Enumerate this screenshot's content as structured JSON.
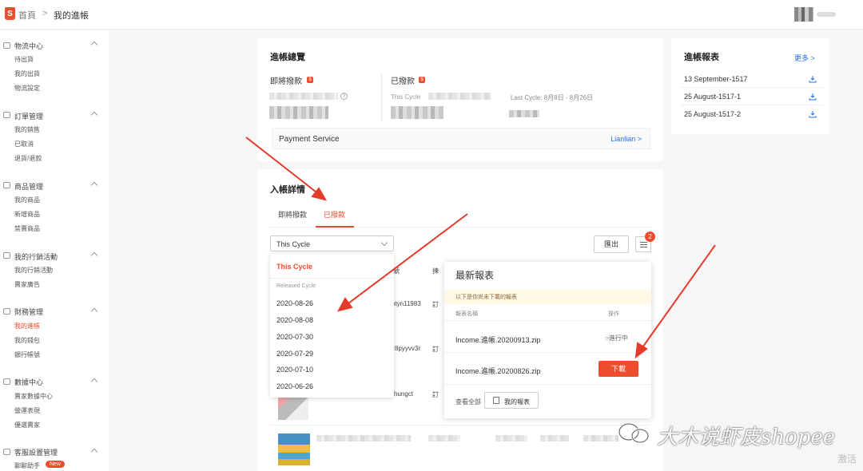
{
  "header": {
    "logo": "S",
    "home": "首頁",
    "separator": ">",
    "current": "我的進帳"
  },
  "sidebar": {
    "sections": [
      {
        "title": "物流中心",
        "items": [
          "待出貨",
          "我的出貨",
          "物流設定"
        ]
      },
      {
        "title": "訂單管理",
        "items": [
          "我的銷售",
          "已取消",
          "退貨/退款"
        ]
      },
      {
        "title": "商品管理",
        "items": [
          "我的商品",
          "新增商品",
          "禁賣商品"
        ]
      },
      {
        "title": "我的行銷活動",
        "items": [
          "我的行銷活動",
          "賣家廣告"
        ]
      },
      {
        "title": "財務管理",
        "items": [
          "我的進帳",
          "我的錢包",
          "銀行帳號"
        ]
      },
      {
        "title": "數據中心",
        "items": [
          "賣家數據中心",
          "營運表現",
          "優選賣家"
        ]
      },
      {
        "title": "客服設置管理",
        "items": [
          "聊聊助手"
        ]
      }
    ],
    "new_badge": "New"
  },
  "overview": {
    "title": "進帳總覽",
    "upcoming_label": "即將撥款",
    "released_label": "已撥款",
    "this_cycle_label": "This Cycle",
    "last_cycle": "Last Cycle: 8月8日 - 8月26日",
    "payment_service": "Payment Service",
    "payment_link": "Lianlian >"
  },
  "details": {
    "title": "入帳詳情",
    "tabs": [
      "即將撥款",
      "已撥款"
    ],
    "select_value": "This Cycle",
    "export_button": "匯出",
    "badge_count": "2",
    "col_partial": "號",
    "col2_partial": "揀",
    "row_texts": [
      "ptyn11983",
      "訂",
      "z8pyyvv3r",
      "訂",
      "hungct",
      "訂"
    ]
  },
  "dropdown": {
    "current": "This Cycle",
    "group": "Released Cycle",
    "options": [
      "2020-08-26",
      "2020-08-08",
      "2020-07-30",
      "2020-07-29",
      "2020-07-10",
      "2020-06-26"
    ]
  },
  "latest_reports": {
    "title": "最新報表",
    "note": "以下是你尚未下載的報表",
    "col_name": "報表名稱",
    "col_action": "操作",
    "files": [
      {
        "name": "Income.進帳.20200913.zip",
        "status": "○進行中"
      },
      {
        "name": "Income.進帳.20200826.zip",
        "action": "下載"
      }
    ],
    "view_all": "查看全部",
    "my_reports_button": "我的報表"
  },
  "reports_panel": {
    "title": "進帳報表",
    "more": "更多 >",
    "items": [
      "13 September-1517",
      "25 August-1517-1",
      "25 August-1517-2"
    ]
  },
  "overlay": {
    "watermark": "大木说虾皮shopee",
    "activate": "激活"
  },
  "colors": {
    "brand": "#ee4d2d",
    "link": "#2673dd",
    "arrow": "#e53a2a"
  }
}
